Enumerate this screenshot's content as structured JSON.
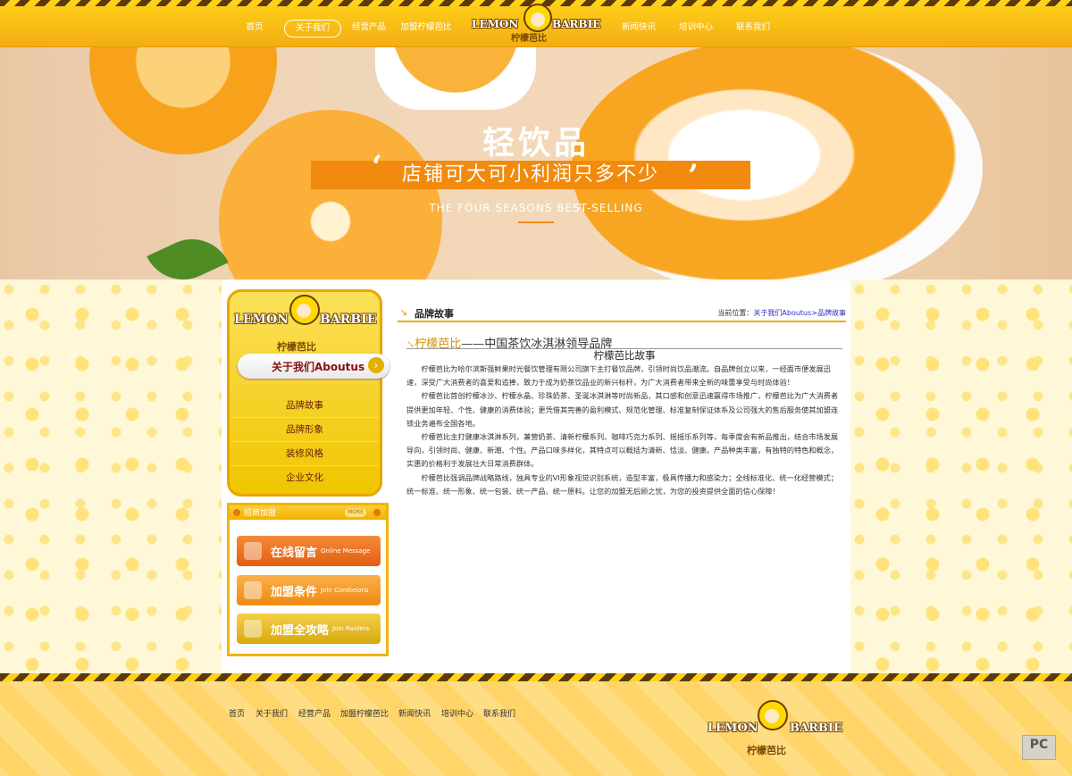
{
  "nav": {
    "left": [
      "首页",
      "关于我们",
      "经营产品",
      "加盟柠檬芭比"
    ],
    "right": [
      "新闻快讯",
      "培训中心",
      "联系我们"
    ],
    "active_index": 1
  },
  "logo": {
    "left": "LEMON",
    "right": "BARBIE",
    "cn": "柠檬芭比"
  },
  "hero": {
    "title": "轻饮品",
    "slogan": "店铺可大可小利润只多不少",
    "quote_open": "‘",
    "quote_close": "’",
    "subtitle": "THE FOUR SEASONS BEST-SELLING"
  },
  "sidebar": {
    "about_label": "关于我们Aboutus",
    "arrow": "›",
    "menu": [
      "品牌故事",
      "品牌形象",
      "装修风格",
      "企业文化"
    ],
    "join": {
      "title": "招商加盟",
      "more": "MORE",
      "buttons": [
        {
          "cn": "在线留言",
          "en": "Online Message"
        },
        {
          "cn": "加盟条件",
          "en": "Join Condieions"
        },
        {
          "cn": "加盟全攻略",
          "en": "Join Raiders"
        }
      ]
    }
  },
  "breadcrumb": {
    "icon": "↘",
    "title": "品牌故事",
    "prefix": "当前位置：",
    "link": "关于我们Aboutus>品牌故事"
  },
  "article": {
    "arrow": "↘",
    "brand": "柠檬芭比",
    "headline": "——中国茶饮冰淇淋领导品牌",
    "subtitle": "柠檬芭比故事",
    "paragraphs": [
      "柠檬芭比为哈尔滨斯强鲜果时光餐饮管理有限公司旗下主打餐饮品牌，引领时尚饮品潮流。自品牌创立以来，一经面市便发展迅速，深受广大消费者的喜爱和追捧，致力于成为奶茶饮品业的新兴标杆，为广大消费者带来全新的味蕾享受与时尚体验！",
      "柠檬芭比首创柠檬冰沙、柠檬水晶、珍珠奶茶、圣诞冰淇淋等时尚新品，其口感和创意迅速赢得市场推广，柠檬芭比为广大消费者提供更加年轻、个性、健康的消费体验；更凭借其完善的盈利模式、规范化管理、标准复制保证体系及公司强大的售后服务使其加盟连锁业务遍布全国各地。",
      "柠檬芭比主打健康冰淇淋系列，兼营奶茶、清新柠檬系列、咖啡巧克力系列、摇摇乐系列等，每季度会有新品推出，结合市场发展导向，引领时尚、健康、新潮、个性。产品口味多样化，其特点可以概括为清新、恬淡、健康。产品种类丰富，有独特的特色和概念，实惠的价格利于发展壮大日常消费群体。",
      "柠檬芭比强调品牌战略路线，独具专业的VI形象视觉识别系统，造型丰富，极具传播力和感染力；全线标准化、统一化经营模式；统一标准、统一形象、统一包装、统一产品、统一原料。让您的加盟无后顾之忧，为您的投资提供全面的信心保障！"
    ]
  },
  "footer": {
    "nav": [
      "首页",
      "关于我们",
      "经营产品",
      "加盟柠檬芭比",
      "新闻快讯",
      "培训中心",
      "联系我们"
    ]
  },
  "watermark": "PC",
  "colors": {
    "accent": "#f2a60f",
    "brand_orange": "#f28a0d",
    "dark_brown": "#6b3f06"
  }
}
